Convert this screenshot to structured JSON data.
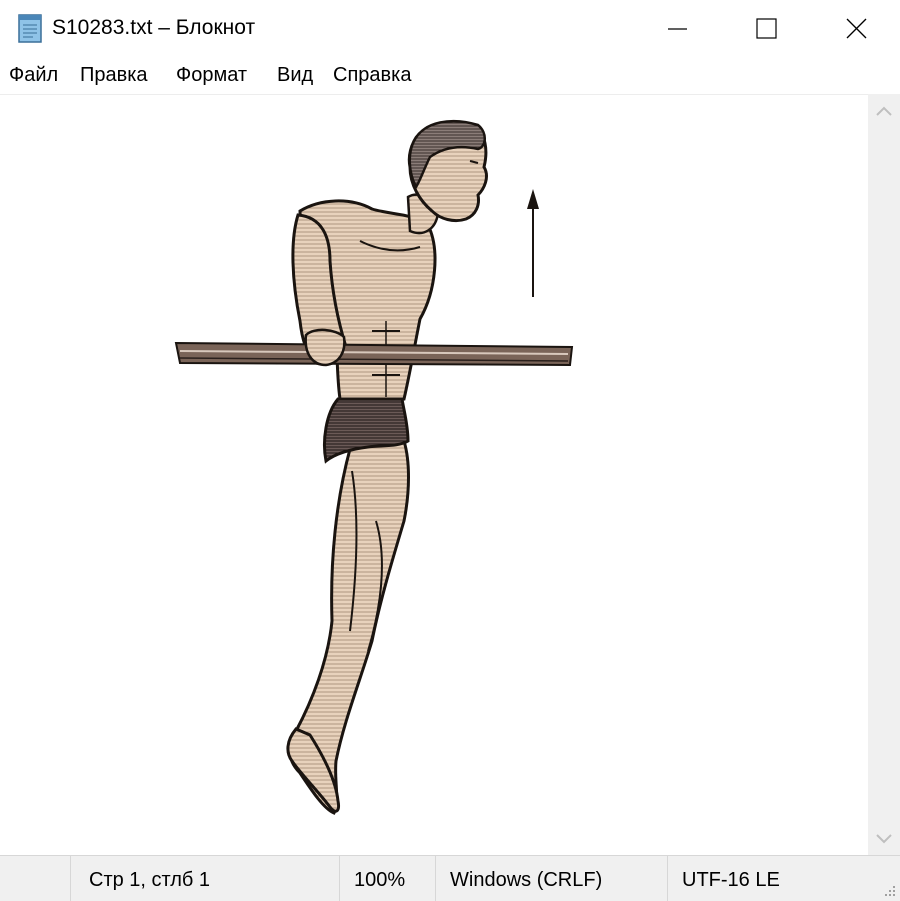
{
  "window": {
    "title": "S10283.txt – Блокнот",
    "controls": [
      "minimize",
      "maximize",
      "close"
    ]
  },
  "menu": {
    "items": [
      "Файл",
      "Правка",
      "Формат",
      "Вид",
      "Справка"
    ]
  },
  "editor": {
    "content": "ASCII-art illustration of a man performing a dip exercise on parallel bars with an upward arrow",
    "icon": "figure-illustration"
  },
  "status": {
    "position": "Стр 1, стлб 1",
    "zoom": "100%",
    "line_endings": "Windows (CRLF)",
    "encoding": "UTF-16 LE"
  },
  "colors": {
    "skin": "#e8d2bc",
    "outline": "#1a1410",
    "hair": "#8b7d78",
    "trunks": "#6b5a57",
    "bar": "#7a6458",
    "statusbar": "#f0f0f0",
    "scrollbar": "#f0f0f0"
  }
}
